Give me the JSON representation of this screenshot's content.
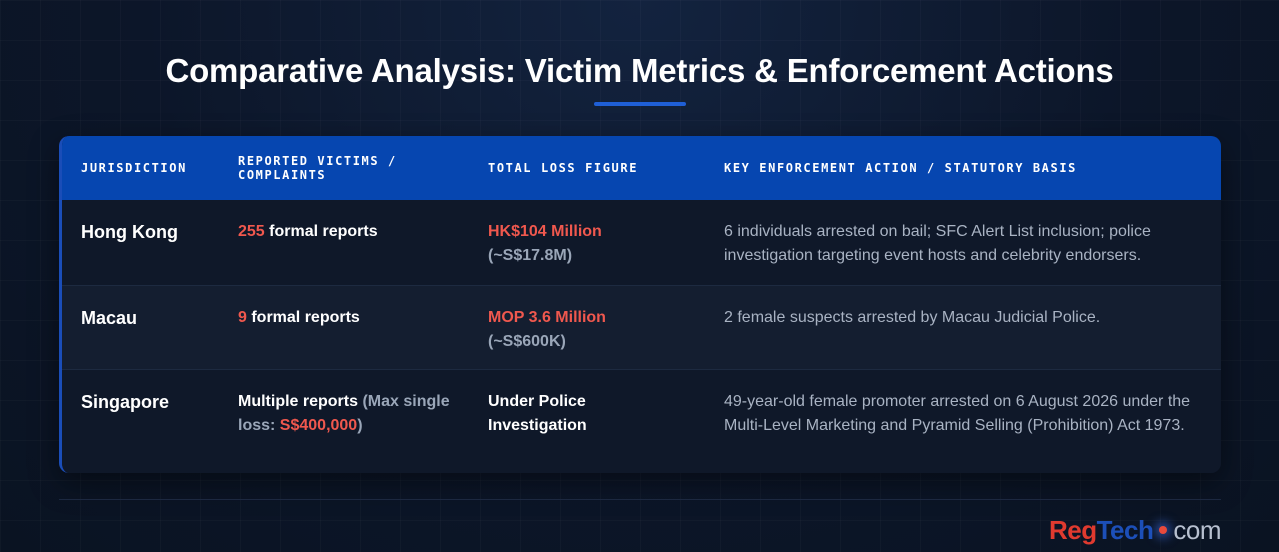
{
  "title": "Comparative Analysis: Victim Metrics & Enforcement Actions",
  "table": {
    "headers": {
      "jurisdiction": "JURISDICTION",
      "victims_line1": "REPORTED VICTIMS /",
      "victims_line2": "COMPLAINTS",
      "loss": "TOTAL LOSS FIGURE",
      "action": "KEY ENFORCEMENT ACTION / STATUTORY BASIS"
    },
    "rows": [
      {
        "jurisdiction": "Hong Kong",
        "victims_count": "255",
        "victims_text": " formal reports",
        "loss_primary": "HK$104 Million",
        "loss_secondary": "(~S$17.8M)",
        "action": "6 individuals arrested on bail; SFC Alert List inclusion; police investigation targeting event hosts and celebrity endorsers."
      },
      {
        "jurisdiction": "Macau",
        "victims_count": "9",
        "victims_text": " formal reports",
        "loss_primary": "MOP 3.6 Million",
        "loss_secondary": "(~S$600K)",
        "action": "2 female suspects arrested by Macau Judicial Police."
      },
      {
        "jurisdiction": "Singapore",
        "victims_text": "Multiple reports",
        "victims_note_open": " (Max single loss: ",
        "victims_note_amount": "S$400,000",
        "victims_note_close": ")",
        "loss_primary": "Under Police Investigation",
        "action": "49-year-old female promoter arrested on 6 August 2026 under the Multi-Level Marketing and Pyramid Selling (Prohibition) Act 1973."
      }
    ]
  },
  "logo": {
    "part1": "Reg",
    "part2": "Tech",
    "part3": "com"
  }
}
